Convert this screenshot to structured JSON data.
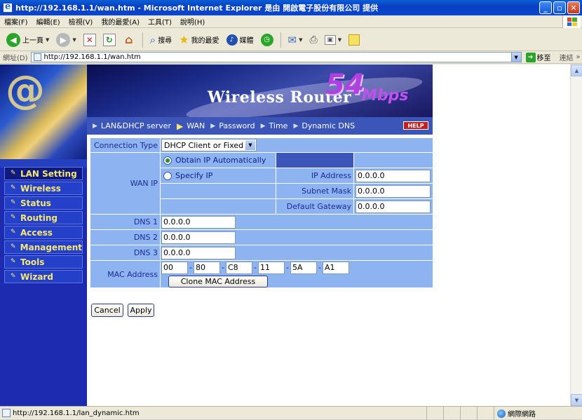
{
  "window": {
    "title": "http://192.168.1.1/wan.htm - Microsoft Internet Explorer 是由 開啟電子股份有限公司 提供"
  },
  "menu": [
    "檔案(F)",
    "編輯(E)",
    "檢視(V)",
    "我的最愛(A)",
    "工具(T)",
    "說明(H)"
  ],
  "toolbar": {
    "back_label": "上一頁",
    "search_label": "搜尋",
    "favorites_label": "我的最愛",
    "media_label": "媒體"
  },
  "address": {
    "label": "網址(D)",
    "url": "http://192.168.1.1/wan.htm",
    "go_label": "移至",
    "links_label": "連結"
  },
  "sidebar": {
    "items": [
      "LAN Setting",
      "Wireless",
      "Status",
      "Routing",
      "Access",
      "Management",
      "Tools",
      "Wizard"
    ],
    "active": "LAN Setting"
  },
  "banner": {
    "brand": "Wireless Router",
    "speed": "54",
    "unit": "Mbps"
  },
  "tabs": {
    "items": [
      "LAN&DHCP server",
      "WAN",
      "Password",
      "Time",
      "Dynamic DNS"
    ],
    "active": "WAN",
    "help_label": "HELP"
  },
  "form": {
    "connection_type_label": "Connection Type",
    "connection_type_value": "DHCP Client or Fixed IP",
    "wan_ip_label": "WAN IP",
    "obtain_label": "Obtain IP Automatically",
    "specify_label": "Specify IP",
    "ip_address_label": "IP Address",
    "ip_address_value": "0.0.0.0",
    "subnet_mask_label": "Subnet Mask",
    "subnet_mask_value": "0.0.0.0",
    "gateway_label": "Default Gateway",
    "gateway_value": "0.0.0.0",
    "dns1_label": "DNS 1",
    "dns1_value": "0.0.0.0",
    "dns2_label": "DNS 2",
    "dns2_value": "0.0.0.0",
    "dns3_label": "DNS 3",
    "dns3_value": "0.0.0.0",
    "mac_label": "MAC Address",
    "mac": [
      "00",
      "80",
      "C8",
      "11",
      "5A",
      "A1"
    ],
    "clone_label": "Clone MAC Address",
    "cancel_label": "Cancel",
    "apply_label": "Apply",
    "selected_mode": "obtain"
  },
  "status": {
    "text": "http://192.168.1.1/lan_dynamic.htm",
    "zone": "網際網路"
  }
}
